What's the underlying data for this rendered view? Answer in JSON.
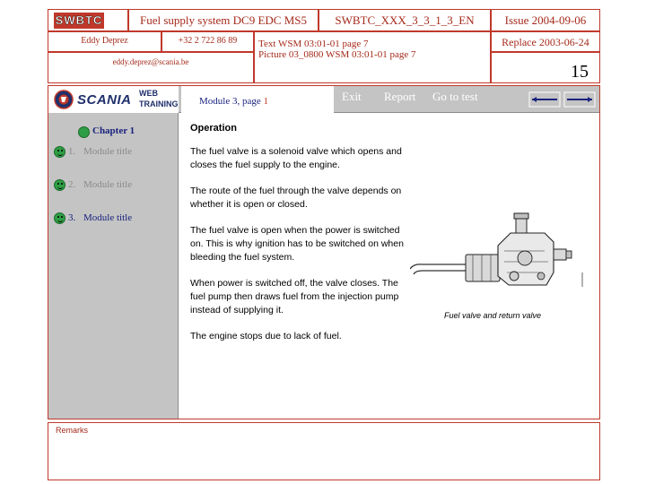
{
  "header": {
    "logo_text": "SWBTC",
    "title": "Fuel supply system DC9 EDC MS5",
    "code": "SWBTC_XXX_3_3_1_3_EN",
    "issue": "Issue 2004-09-06",
    "author": "Eddy Deprez",
    "phone": "+32 2 722 86 89",
    "email": "eddy.deprez@scania.be",
    "text_ref": "Text WSM 03:01-01 page 7",
    "picture_ref": "Picture 03_0800 WSM 03:01-01 page 7",
    "replace": "Replace 2003-06-24",
    "page_number": "15"
  },
  "nav": {
    "brand": "SCANIA",
    "brand_sub_1": "WEB",
    "brand_sub_2": "TRAINING",
    "module_label": "Module 3, page ",
    "module_page": "1",
    "exit": "Exit",
    "report": "Report",
    "goto_test": "Go to test"
  },
  "sidebar": {
    "chapter": "Chapter 1",
    "items": [
      {
        "num": "1.",
        "label": "Module title"
      },
      {
        "num": "2.",
        "label": "Module title"
      },
      {
        "num": "3.",
        "label": "Module title"
      }
    ]
  },
  "content": {
    "heading": "Operation",
    "paragraphs": [
      "The fuel valve is a solenoid valve which opens and closes the fuel supply to the engine.",
      "The route of the fuel through the valve depends on whether it is open or closed.",
      "The fuel valve is open when the power is switched on. This is why ignition has to be switched on when bleeding the fuel system.",
      "When power is switched off, the valve closes. The fuel pump then draws fuel from the injection pump instead of supplying it.",
      "The engine stops due to lack of fuel."
    ],
    "image_caption": "Fuel valve and return valve"
  },
  "remarks": {
    "label": "Remarks"
  },
  "colors": {
    "border": "#c0392b",
    "nav_grey": "#c4c4c4",
    "active_link": "#1a237e",
    "inactive_link": "#8a8a8a",
    "smiley": "#2e9e44"
  }
}
